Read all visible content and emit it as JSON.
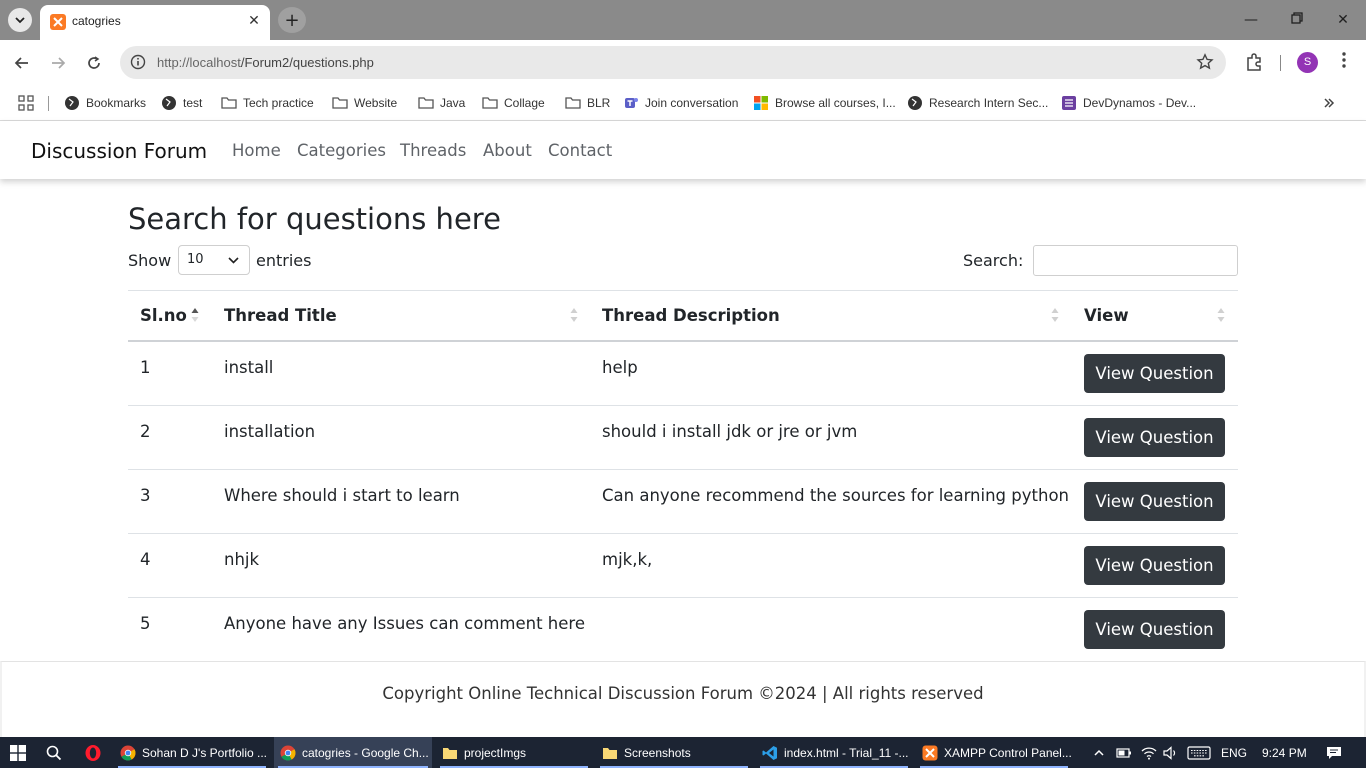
{
  "browser": {
    "tab_title": "catogries",
    "url_host": "http://localhost",
    "url_path": "/Forum2/questions.php",
    "profile_initial": "S",
    "bookmarks": [
      "Bookmarks",
      "test",
      "Tech practice",
      "Website",
      "Java",
      "Collage",
      "BLR",
      "Join conversation",
      "Browse all courses, I...",
      "Research Intern Sec...",
      "DevDynamos - Dev..."
    ]
  },
  "navbar": {
    "brand": "Discussion Forum",
    "links": [
      "Home",
      "Categories",
      "Threads",
      "About",
      "Contact"
    ]
  },
  "page": {
    "heading": "Search for questions here",
    "show_label": "Show",
    "entries_value": "10",
    "entries_label": "entries",
    "search_label": "Search:"
  },
  "table": {
    "headers": [
      "Sl.no",
      "Thread Title",
      "Thread Description",
      "View"
    ],
    "button_label": "View Question",
    "rows": [
      {
        "no": "1",
        "title": "install",
        "desc": "help"
      },
      {
        "no": "2",
        "title": "installation",
        "desc": "should i install jdk or jre or jvm"
      },
      {
        "no": "3",
        "title": "Where should i start to learn",
        "desc": "Can anyone recommend the sources for learning python"
      },
      {
        "no": "4",
        "title": "nhjk",
        "desc": "mjk,k,"
      },
      {
        "no": "5",
        "title": "Anyone have any Issues can comment here",
        "desc": ""
      }
    ]
  },
  "footer": {
    "text": "Copyright Online Technical Discussion Forum ©2024 | All rights reserved"
  },
  "taskbar": {
    "apps": [
      "Sohan D J's Portfolio ...",
      "catogries - Google Ch...",
      "projectImgs",
      "Screenshots",
      "index.html - Trial_11 -...",
      "XAMPP Control Panel..."
    ],
    "lang": "ENG",
    "time": "9:24 PM"
  },
  "colors": {
    "button_dark": "#343a40",
    "tab_strip": "#8a8a8a",
    "taskbar": "#1c2433"
  }
}
